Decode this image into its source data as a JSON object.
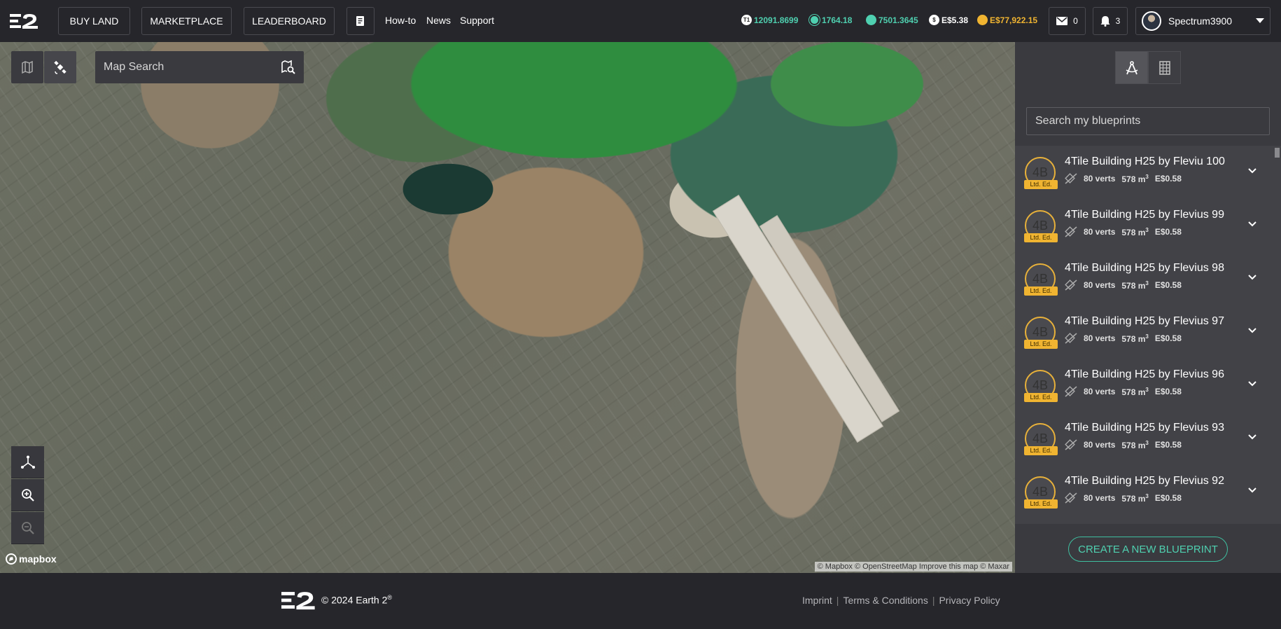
{
  "header": {
    "nav_buttons": [
      "BUY LAND",
      "MARKETPLACE",
      "LEADERBOARD"
    ],
    "links": [
      "How-to",
      "News",
      "Support"
    ],
    "balances": [
      {
        "label": "T1",
        "value": "12091.8699",
        "color": "#4fd0b0"
      },
      {
        "label": "",
        "value": "1764.18",
        "color": "#4fd0b0"
      },
      {
        "label": "",
        "value": "7501.3645",
        "color": "#4fd0b0"
      },
      {
        "label": "$",
        "value": "E$5.38",
        "color": "#ffffff"
      },
      {
        "label": "",
        "value": "E$77,922.15",
        "color": "#f0b431"
      }
    ],
    "messages_count": "0",
    "notifications_count": "3",
    "username": "Spectrum3900"
  },
  "map": {
    "search_placeholder": "Map Search",
    "logo_text": "mapbox",
    "attribution": "© Mapbox © OpenStreetMap  Improve this map  © Maxar"
  },
  "panel": {
    "search_placeholder": "Search my blueprints",
    "badge": "4B",
    "ltd_label": "Ltd. Ed.",
    "blueprints": [
      {
        "title": "4Tile Building H25 by Fleviu 100",
        "verts": "80 verts",
        "volume": "578 m",
        "volume_unit": "3",
        "price": "E$0.58"
      },
      {
        "title": "4Tile Building H25 by Flevius 99",
        "verts": "80 verts",
        "volume": "578 m",
        "volume_unit": "3",
        "price": "E$0.58"
      },
      {
        "title": "4Tile Building H25 by Flevius 98",
        "verts": "80 verts",
        "volume": "578 m",
        "volume_unit": "3",
        "price": "E$0.58"
      },
      {
        "title": "4Tile Building H25 by Flevius 97",
        "verts": "80 verts",
        "volume": "578 m",
        "volume_unit": "3",
        "price": "E$0.58"
      },
      {
        "title": "4Tile Building H25 by Flevius 96",
        "verts": "80 verts",
        "volume": "578 m",
        "volume_unit": "3",
        "price": "E$0.58"
      },
      {
        "title": "4Tile Building H25 by Flevius 93",
        "verts": "80 verts",
        "volume": "578 m",
        "volume_unit": "3",
        "price": "E$0.58"
      },
      {
        "title": "4Tile Building H25 by Flevius 92",
        "verts": "80 verts",
        "volume": "578 m",
        "volume_unit": "3",
        "price": "E$0.58"
      }
    ],
    "create_button": "CREATE A NEW BLUEPRINT"
  },
  "footer": {
    "copyright": "© 2024 Earth 2",
    "copyright_mark": "®",
    "links": [
      "Imprint",
      "Terms & Conditions",
      "Privacy Policy"
    ]
  }
}
